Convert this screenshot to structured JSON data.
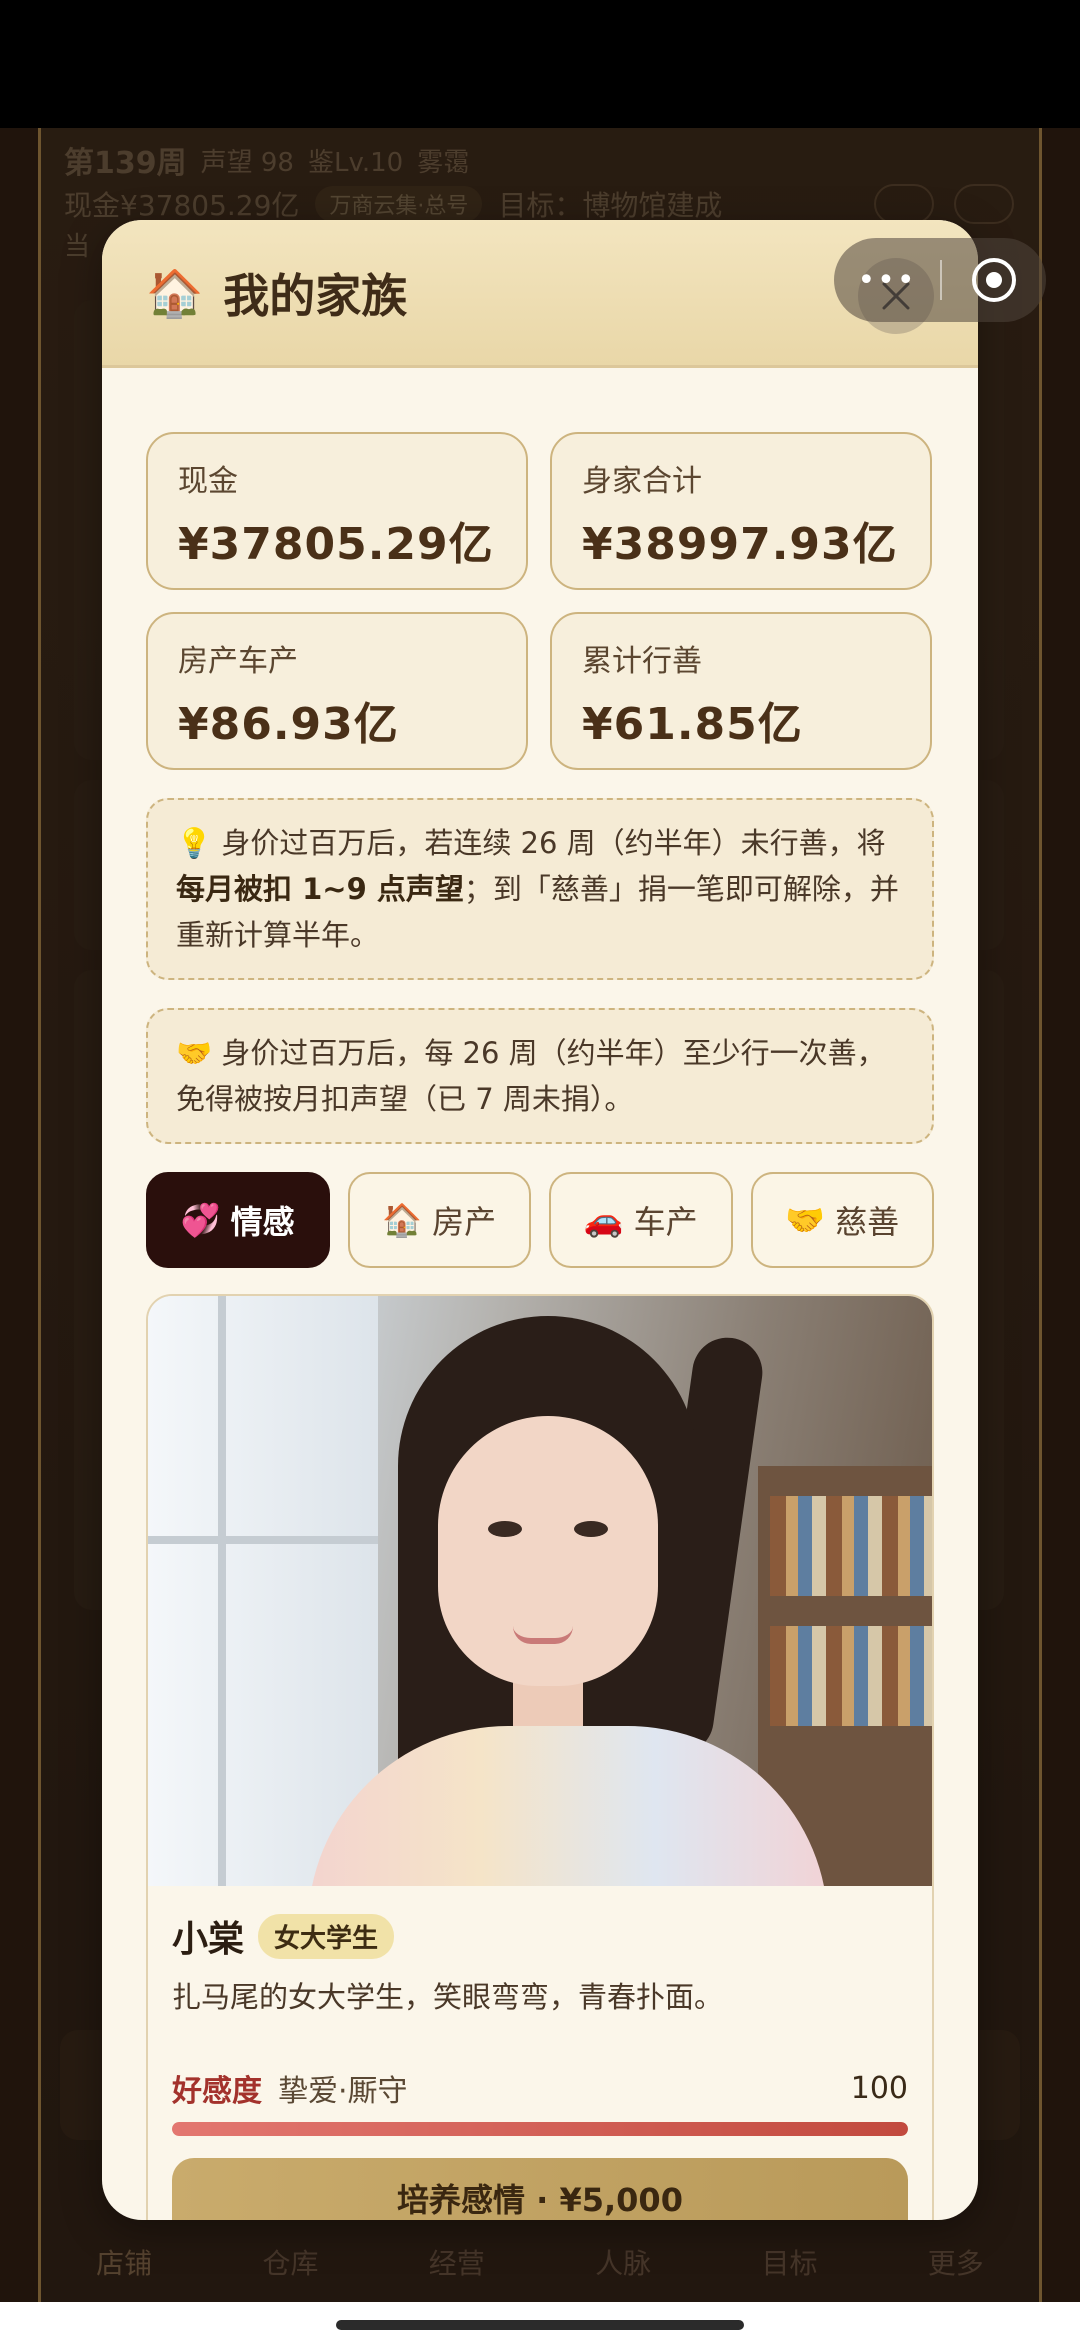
{
  "game": {
    "week": "第139周",
    "reputation": "声望 98",
    "appraisal": "鉴Lv.10",
    "weather": "雾霭",
    "cash": "现金¥37805.29亿",
    "tag": "万商云集·总号",
    "goal": "目标：博物馆建成",
    "line3": "当"
  },
  "nav": {
    "items": [
      "店铺",
      "仓库",
      "经营",
      "人脉",
      "目标",
      "更多"
    ]
  },
  "modal": {
    "title": "我的家族",
    "stats": [
      {
        "label": "现金",
        "value": "¥37805.29亿"
      },
      {
        "label": "身家合计",
        "value": "¥38997.93亿"
      },
      {
        "label": "房产车产",
        "value": "¥86.93亿"
      },
      {
        "label": "累计行善",
        "value": "¥61.85亿"
      }
    ],
    "notice1": {
      "icon": "💡",
      "pre": "身价过百万后，若连续 26 周（约半年）未行善，将",
      "bold": "每月被扣 1~9 点声望",
      "post": "；到「慈善」捐一笔即可解除，并重新计算半年。"
    },
    "notice2": {
      "icon": "🤝",
      "text": "身价过百万后，每 26 周（约半年）至少行一次善，免得被按月扣声望（已 7 周未捐）。"
    },
    "tabs": [
      {
        "icon": "💞",
        "label": "情感"
      },
      {
        "icon": "🏠",
        "label": "房产"
      },
      {
        "icon": "🚗",
        "label": "车产"
      },
      {
        "icon": "🤝",
        "label": "慈善"
      }
    ],
    "character": {
      "name": "小棠",
      "tag": "女大学生",
      "desc": "扎马尾的女大学生，笑眼弯弯，青春扑面。",
      "affinity_label": "好感度",
      "affinity_status": "挚爱·厮守",
      "affinity_value": "100",
      "affinity_fraction": 1.0
    },
    "train_button": "培养感情 · ¥5,000"
  },
  "colors": {
    "accent_dark": "#2a0f0c",
    "gold": "#c9ab6c",
    "affinity_red": "#c24a3e"
  }
}
